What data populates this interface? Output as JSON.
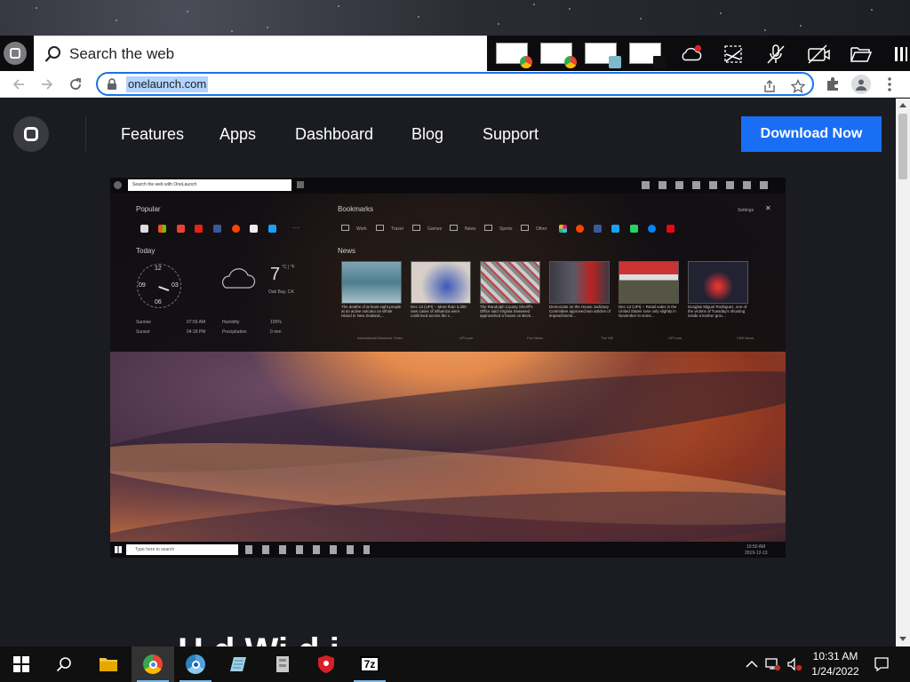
{
  "dock": {
    "search_placeholder": "Search the web",
    "thumbnails": [
      {
        "name": "window-thumb-chrome-1",
        "badge": "chrome-icon"
      },
      {
        "name": "window-thumb-chrome-2",
        "badge": "chrome-icon"
      },
      {
        "name": "window-thumb-notepad",
        "badge": "notepad-icon"
      },
      {
        "name": "window-thumb-7zip",
        "badge": "7zip-icon"
      }
    ],
    "cloud_badge": "N/A"
  },
  "browser": {
    "url": "onelaunch.com"
  },
  "site": {
    "nav": [
      "Features",
      "Apps",
      "Dashboard",
      "Blog",
      "Support"
    ],
    "download_label": "Download Now",
    "download_color": "#1a6ef5",
    "headline_partial": "H     d        Wi  d          i"
  },
  "hero": {
    "search_placeholder": "Search the web with OneLaunch",
    "popular_label": "Popular",
    "bookmarks_label": "Bookmarks",
    "settings_label": "Settings",
    "today_label": "Today",
    "news_label": "News",
    "clock_numbers": [
      "12",
      "03",
      "06",
      "09"
    ],
    "temperature": "7",
    "temp_units": "°C | °F",
    "location": "Oak Bay, CA",
    "sunrise_label": "Sunrise",
    "sunrise": "07:56 AM",
    "sunset_label": "Sunset",
    "sunset": "04:18 PM",
    "humidity_label": "Humidity",
    "humidity": "100%",
    "precip_label": "Precipitation",
    "precip": "0 mm",
    "bookmarks": [
      "Work",
      "Travel",
      "Games",
      "News",
      "Sports",
      "Other"
    ],
    "news": [
      {
        "text": "The deaths of at least eight people at an active volcano on White Island in New Zealand,...",
        "source": "International Business Times"
      },
      {
        "text": "Dec 13 (UPI) -- More than 4,300 new cases of influenza were confirmed across the c...",
        "source": "UPI.com"
      },
      {
        "text": "The Randolph County Sheriff's Office said Virginia Seaweed approached a house on Beck...",
        "source": "Fox News"
      },
      {
        "text": "Democrats on the House Judiciary Committee approved two articles of impeachment...",
        "source": "The Hill"
      },
      {
        "text": "Dec 13 (UPI) -- Retail sales in the United States rose only slightly in November in some...",
        "source": "UPI.com"
      },
      {
        "text": "Douglas Miguel Rodriguez, one of the victims of Tuesday's shooting inside a kosher groc...",
        "source": "CBS News"
      }
    ],
    "taskbar_search": "Type here to search",
    "taskbar_time": "10:50 AM",
    "taskbar_date": "2019-12-13"
  },
  "taskbar": {
    "time": "10:31 AM",
    "date": "1/24/2022"
  }
}
